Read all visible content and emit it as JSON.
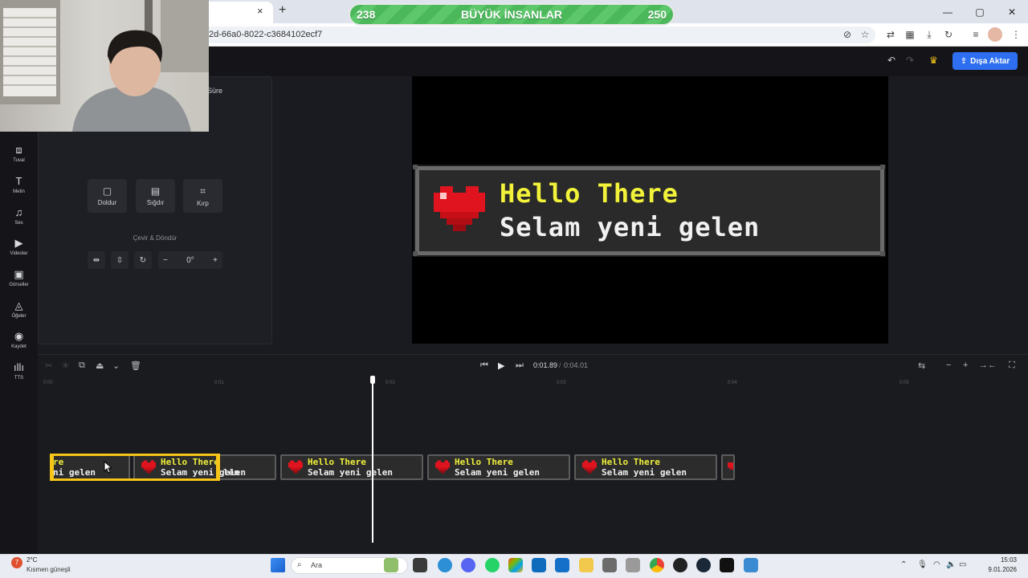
{
  "browser": {
    "url": "2d-66a0-8022-c3684102ecf7",
    "tab_close": "×",
    "new_tab": "+",
    "window_controls": [
      "—",
      "▢",
      "✕"
    ]
  },
  "banner": {
    "left_score": "238",
    "title": "BÜYÜK İNSANLAR",
    "right_score": "250"
  },
  "header": {
    "export_label": "Dışa Aktar"
  },
  "leftnav": {
    "items": [
      {
        "label": "Tuval",
        "icon": "canvas-icon"
      },
      {
        "label": "Metin",
        "icon": "text-icon"
      },
      {
        "label": "Ses",
        "icon": "music-icon"
      },
      {
        "label": "Videolar",
        "icon": "video-icon"
      },
      {
        "label": "Görseller",
        "icon": "image-icon"
      },
      {
        "label": "Öğeler",
        "icon": "shapes-icon"
      },
      {
        "label": "Kaydet",
        "icon": "record-icon"
      },
      {
        "label": "TTS",
        "icon": "waveform-icon"
      }
    ]
  },
  "panel": {
    "tab_label": "Süre",
    "fit_buttons": [
      {
        "label": "Doldur",
        "icon": "fill-icon"
      },
      {
        "label": "Sığdır",
        "icon": "fit-icon"
      },
      {
        "label": "Kırp",
        "icon": "crop-icon"
      }
    ],
    "rotate_label": "Çevir & Döndür",
    "rotation_value": "0°"
  },
  "canvas": {
    "line1": "Hello There",
    "line2": "Selam yeni gelen"
  },
  "timeline": {
    "current_time": "0:01.89",
    "separator": "/",
    "total_time": "0:04.01",
    "ticks": [
      "0:00",
      "0:01",
      "0:02",
      "0:03",
      "0:04",
      "0:05"
    ],
    "clips": [
      {
        "line1": "re",
        "line2": "ni gelen"
      },
      {
        "line1": "Hello There",
        "line2": "Selam yeni gelen"
      },
      {
        "line1": "",
        "line2": "len"
      },
      {
        "line1": "Hello There",
        "line2": "Selam yeni gelen"
      },
      {
        "line1": "Hello There",
        "line2": "Selam yeni gelen"
      },
      {
        "line1": "Hello There",
        "line2": "Selam yeni gelen"
      }
    ]
  },
  "taskbar": {
    "temperature": "2°C",
    "weather": "Kısmen güneşli",
    "weather_badge": "7",
    "search_placeholder": "Ara",
    "time": "15:03",
    "date": "9.01.2026"
  },
  "colors": {
    "accent": "#2d6ff0",
    "selection": "#f5c518",
    "title_yellow": "#f2f23a"
  }
}
